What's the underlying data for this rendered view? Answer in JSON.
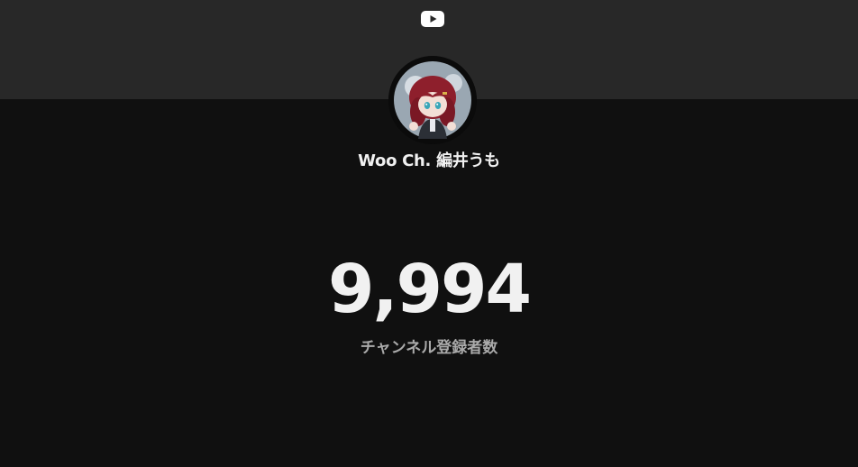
{
  "header": {
    "logo_icon": "youtube-play-icon"
  },
  "channel": {
    "name": "Woo Ch. 編井うも",
    "avatar_icon": "channel-avatar"
  },
  "stats": {
    "subscriber_count": "9,994",
    "subscriber_label": "チャンネル登録者数"
  },
  "colors": {
    "header_background": "#282828",
    "page_background": "#101010",
    "primary_text": "#f1f1f1",
    "secondary_text": "#aaaaaa"
  }
}
